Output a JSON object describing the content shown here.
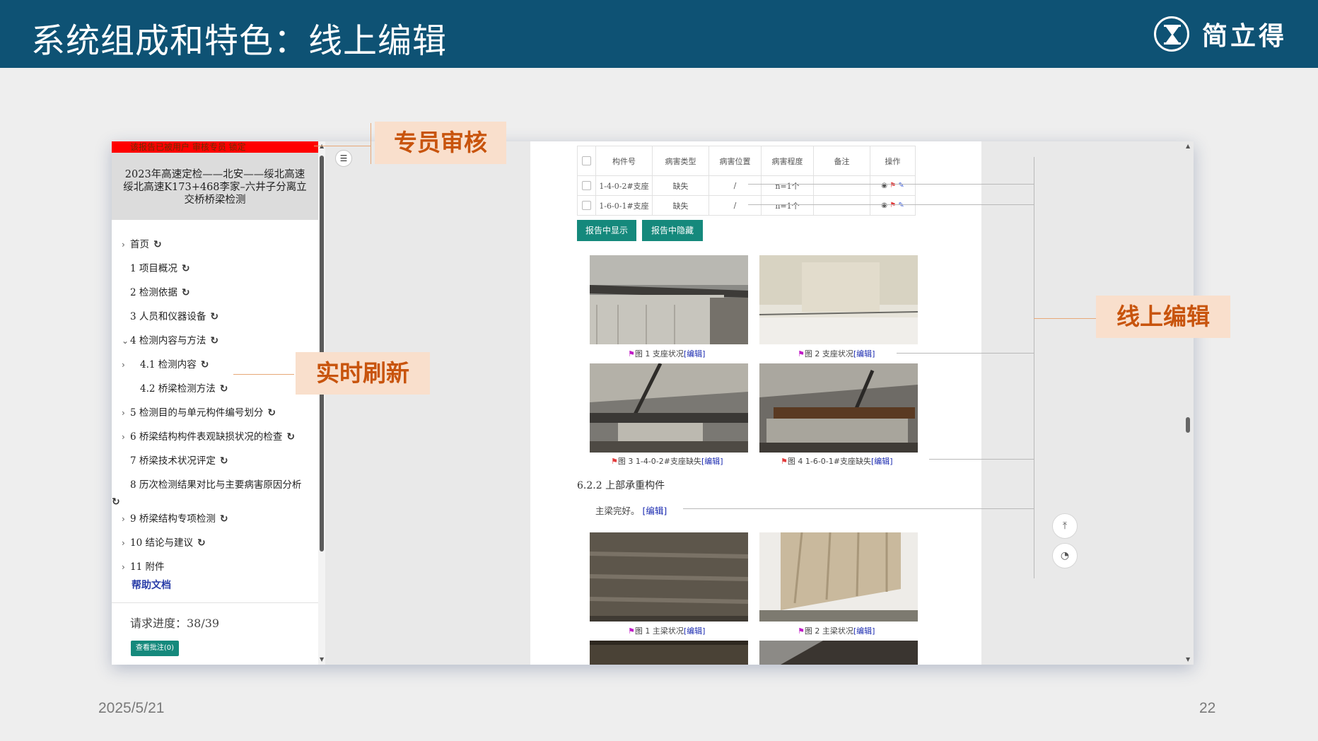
{
  "slide": {
    "title": "系统组成和特色：线上编辑",
    "brand": "简立得",
    "date": "2025/5/21",
    "page_number": "22"
  },
  "callouts": {
    "review": "专员审核",
    "refresh": "实时刷新",
    "edit": "线上编辑"
  },
  "sidebar": {
    "warning": "该报告已被用户 审核专员 锁定",
    "project": "2023年高速定检——北安——绥北高速绥北高速K173+468李家–六井子分离立交桥桥梁检测",
    "items": [
      {
        "chev": "›",
        "label": "首页"
      },
      {
        "chev": "",
        "label": "1 项目概况"
      },
      {
        "chev": "",
        "label": "2 检测依据"
      },
      {
        "chev": "",
        "label": "3 人员和仪器设备"
      },
      {
        "chev": "⌄",
        "label": "4 检测内容与方法"
      },
      {
        "chev": "›",
        "label": "4.1 检测内容"
      },
      {
        "chev": "",
        "label": "4.2 桥梁检测方法"
      },
      {
        "chev": "›",
        "label": "5 检测目的与单元构件编号划分"
      },
      {
        "chev": "›",
        "label": "6 桥梁结构构件表观缺损状况的检查"
      },
      {
        "chev": "",
        "label": "7 桥梁技术状况评定"
      },
      {
        "chev": "",
        "label": "8 历次检测结果对比与主要病害原因分析"
      },
      {
        "chev": "›",
        "label": "9 桥梁结构专项检测"
      },
      {
        "chev": "›",
        "label": "10 结论与建议"
      },
      {
        "chev": "›",
        "label": "11 附件"
      }
    ],
    "help": "帮助文档",
    "progress": "请求进度：38/39",
    "note_button": "查看批注(0)"
  },
  "table": {
    "headers": [
      "构件号",
      "病害类型",
      "病害位置",
      "病害程度",
      "备注",
      "操作"
    ],
    "rows": [
      {
        "id": "1-4-0-2#支座",
        "type": "缺失",
        "pos": "/",
        "deg": "n=1个",
        "note": ""
      },
      {
        "id": "1-6-0-1#支座",
        "type": "缺失",
        "pos": "/",
        "deg": "n=1个",
        "note": ""
      }
    ]
  },
  "buttons": {
    "show": "报告中显示",
    "hide": "报告中隐藏"
  },
  "captions": {
    "c1": "图 1 支座状况",
    "c2": "图 2 支座状况",
    "c3": "图 3 1-4-0-2#支座缺失",
    "c4": "图 4 1-6-0-1#支座缺失",
    "c5": "图 1 主梁状况",
    "c6": "图 2 主梁状况",
    "edit_link": "[编辑]"
  },
  "section": {
    "heading": "6.2.2 上部承重构件",
    "text": "主梁完好。",
    "edit_link": "[编辑]"
  },
  "colors": {
    "title_bar": "#0e5274",
    "accent_green": "#15897c",
    "warning_red": "#ff0000",
    "callout_bg": "#f9dfcc",
    "callout_text": "#c8540d"
  },
  "icons": [
    "hourglass-logo-icon",
    "refresh-icon",
    "list-toggle-icon",
    "eye-icon",
    "flag-icon",
    "edit-icon",
    "back-to-top-icon",
    "palette-icon"
  ]
}
